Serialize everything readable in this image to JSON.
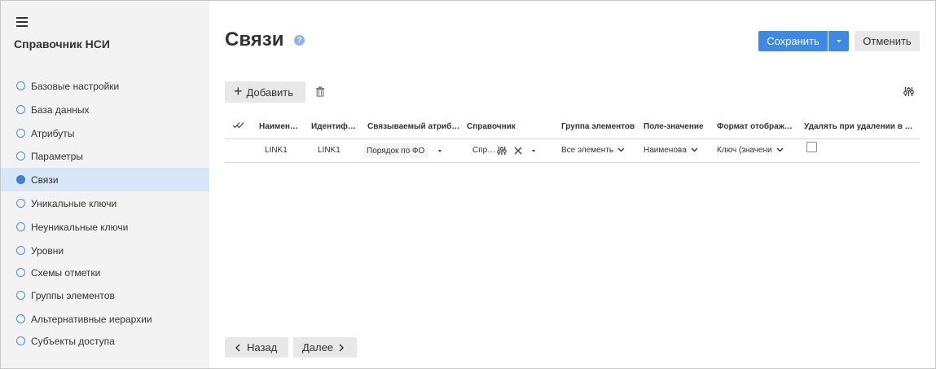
{
  "sidebar": {
    "title": "Справочник НСИ",
    "items": [
      {
        "label": "Базовые настройки",
        "active": false
      },
      {
        "label": "База данных",
        "active": false
      },
      {
        "label": "Атрибуты",
        "active": false
      },
      {
        "label": "Параметры",
        "active": false
      },
      {
        "label": "Связи",
        "active": true
      },
      {
        "label": "Уникальные ключи",
        "active": false
      },
      {
        "label": "Неуникальные ключи",
        "active": false
      },
      {
        "label": "Уровни",
        "active": false
      },
      {
        "label": "Схемы отметки",
        "active": false
      },
      {
        "label": "Группы элементов",
        "active": false
      },
      {
        "label": "Альтернативные иерархии",
        "active": false
      },
      {
        "label": "Субъекты доступа",
        "active": false
      }
    ]
  },
  "page": {
    "title": "Связи",
    "help_icon": "question-circle-icon",
    "help_glyph": "?"
  },
  "toolbar": {
    "save_label": "Сохранить",
    "cancel_label": "Отменить",
    "add_label": "Добавить"
  },
  "table": {
    "columns": [
      "Наимен…",
      "Идентиф…",
      "Связываемый атриб…",
      "Справочник",
      "Группа элементов",
      "Поле-значение",
      "Формат отображ…",
      "Удалять при удалении в …"
    ],
    "rows": [
      {
        "name": "LINK1",
        "id": "LINK1",
        "attribute": "Порядок по ФО",
        "reference": "Спр…",
        "group": "Все элементь",
        "value_field": "Наименова",
        "format": "Ключ (значени",
        "delete_on_delete": false
      }
    ]
  },
  "footer": {
    "back_label": "Назад",
    "next_label": "Далее"
  },
  "colors": {
    "accent": "#3d8ae6",
    "active_item_bg": "#d7e7f8",
    "sidebar_bg": "#f3f3f3"
  }
}
